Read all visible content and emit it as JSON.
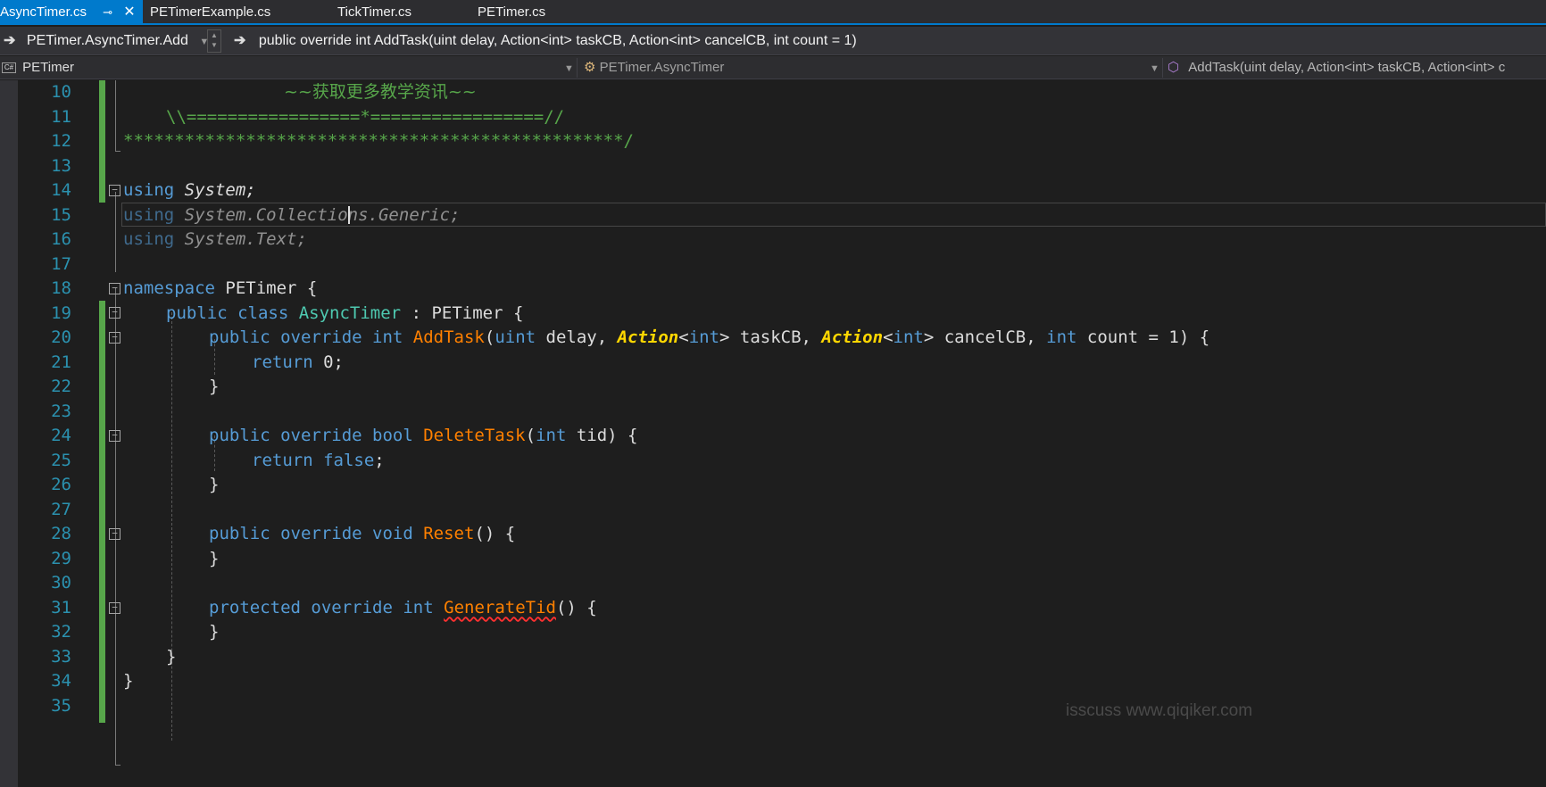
{
  "tabs": [
    {
      "label": "AsyncTimer.cs",
      "active": true
    },
    {
      "label": "PETimerExample.cs",
      "active": false
    },
    {
      "label": "TickTimer.cs",
      "active": false
    },
    {
      "label": "PETimer.cs",
      "active": false
    }
  ],
  "navbar": {
    "member_scope": "PETimer.AsyncTimer.Add",
    "signature": "public override int AddTask(uint delay, Action<int> taskCB, Action<int> cancelCB, int count = 1)"
  },
  "breadcrumb": {
    "project": "PETimer",
    "type": "PETimer.AsyncTimer",
    "member": "AddTask(uint delay, Action<int> taskCB, Action<int> c"
  },
  "line_numbers": [
    "10",
    "11",
    "12",
    "13",
    "14",
    "15",
    "16",
    "17",
    "18",
    "19",
    "20",
    "21",
    "22",
    "23",
    "24",
    "25",
    "26",
    "27",
    "28",
    "29",
    "30",
    "31",
    "32",
    "33",
    "34",
    "35"
  ],
  "code": {
    "l10": "~~获取更多教学资讯~~",
    "l11": "\\\\=================*=================//",
    "l12": "*************************************************/",
    "l14_kw": "using",
    "l14_ns": "System;",
    "l15_kw": "using",
    "l15_ns": "System.Collections.Generic;",
    "l16_kw": "using",
    "l16_ns": "System.Text;",
    "l18_kw": "namespace",
    "l18_rest": "PETimer {",
    "l19_kw": "public class",
    "l19_type": "AsyncTimer",
    "l19_rest": ": PETimer {",
    "l20_kw1": "public override int",
    "l20_method": "AddTask",
    "l20_p1": "(",
    "l20_t1": "uint",
    "l20_p2": " delay, ",
    "l20_a1": "Action",
    "l20_p3": "<",
    "l20_t2": "int",
    "l20_p4": "> taskCB, ",
    "l20_a2": "Action",
    "l20_p5": "<",
    "l20_t3": "int",
    "l20_p6": "> cancelCB, ",
    "l20_t4": "int",
    "l20_p7": " count = 1) {",
    "l21_kw": "return",
    "l21_rest": " 0;",
    "l22": "}",
    "l24_kw": "public override bool",
    "l24_method": "DeleteTask",
    "l24_p1": "(",
    "l24_t1": "int",
    "l24_p2": " tid) {",
    "l25_kw": "return",
    "l25_kw2": "false",
    "l25_rest": ";",
    "l26": "}",
    "l28_kw": "public override void",
    "l28_method": "Reset",
    "l28_rest": "() {",
    "l29": "}",
    "l31_kw": "protected override int",
    "l31_method": "GenerateTid",
    "l31_rest": "() {",
    "l32": "}",
    "l33": "}",
    "l34": "}"
  },
  "watermark": "isscuss www.qiqiker.com"
}
